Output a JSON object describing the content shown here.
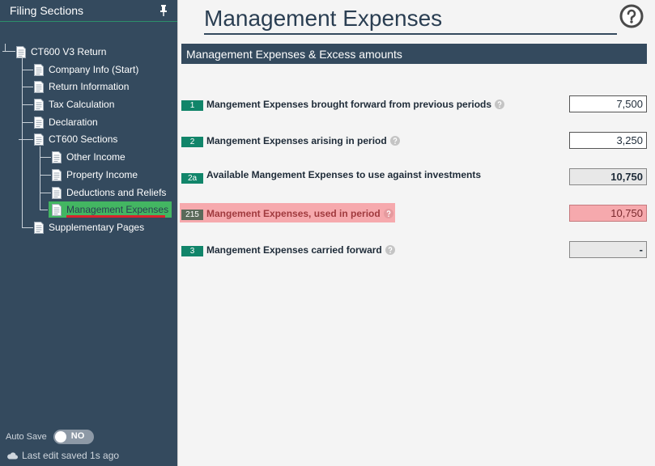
{
  "sidebar": {
    "title": "Filing Sections",
    "collapse_glyph": "»",
    "tree": {
      "root": "CT600 V3 Return",
      "items": [
        "Company Info (Start)",
        "Return Information",
        "Tax Calculation",
        "Declaration",
        "CT600 Sections"
      ],
      "sub_items": [
        "Other Income",
        "Property Income",
        "Deductions and Reliefs",
        "Management Expenses"
      ],
      "after": "Supplementary Pages"
    },
    "autosave": {
      "label": "Auto Save",
      "state": "NO"
    },
    "last_edit": "Last edit saved 1s ago"
  },
  "main": {
    "title": "Management Expenses",
    "section_heading": "Management Expenses & Excess amounts",
    "rows": [
      {
        "code": "1",
        "label": "Mangement Expenses brought forward from previous periods",
        "value": "7,500"
      },
      {
        "code": "2",
        "label": "Mangement Expenses arising in period",
        "value": "3,250"
      },
      {
        "code": "2a",
        "label": "Available Mangement Expenses to use against investments",
        "value": "10,750"
      },
      {
        "code": "215",
        "label": "Mangement Expenses, used in period",
        "value": "10,750"
      },
      {
        "code": "3",
        "label": "Mangement Expenses carried forward",
        "value": "-"
      }
    ]
  },
  "colors": {
    "sidebar_bg": "#344a5e",
    "accent_green": "#11856a",
    "selected_green": "#43b662",
    "highlight_pink": "#f6a9ad",
    "selection_underline": "#d9232e"
  }
}
